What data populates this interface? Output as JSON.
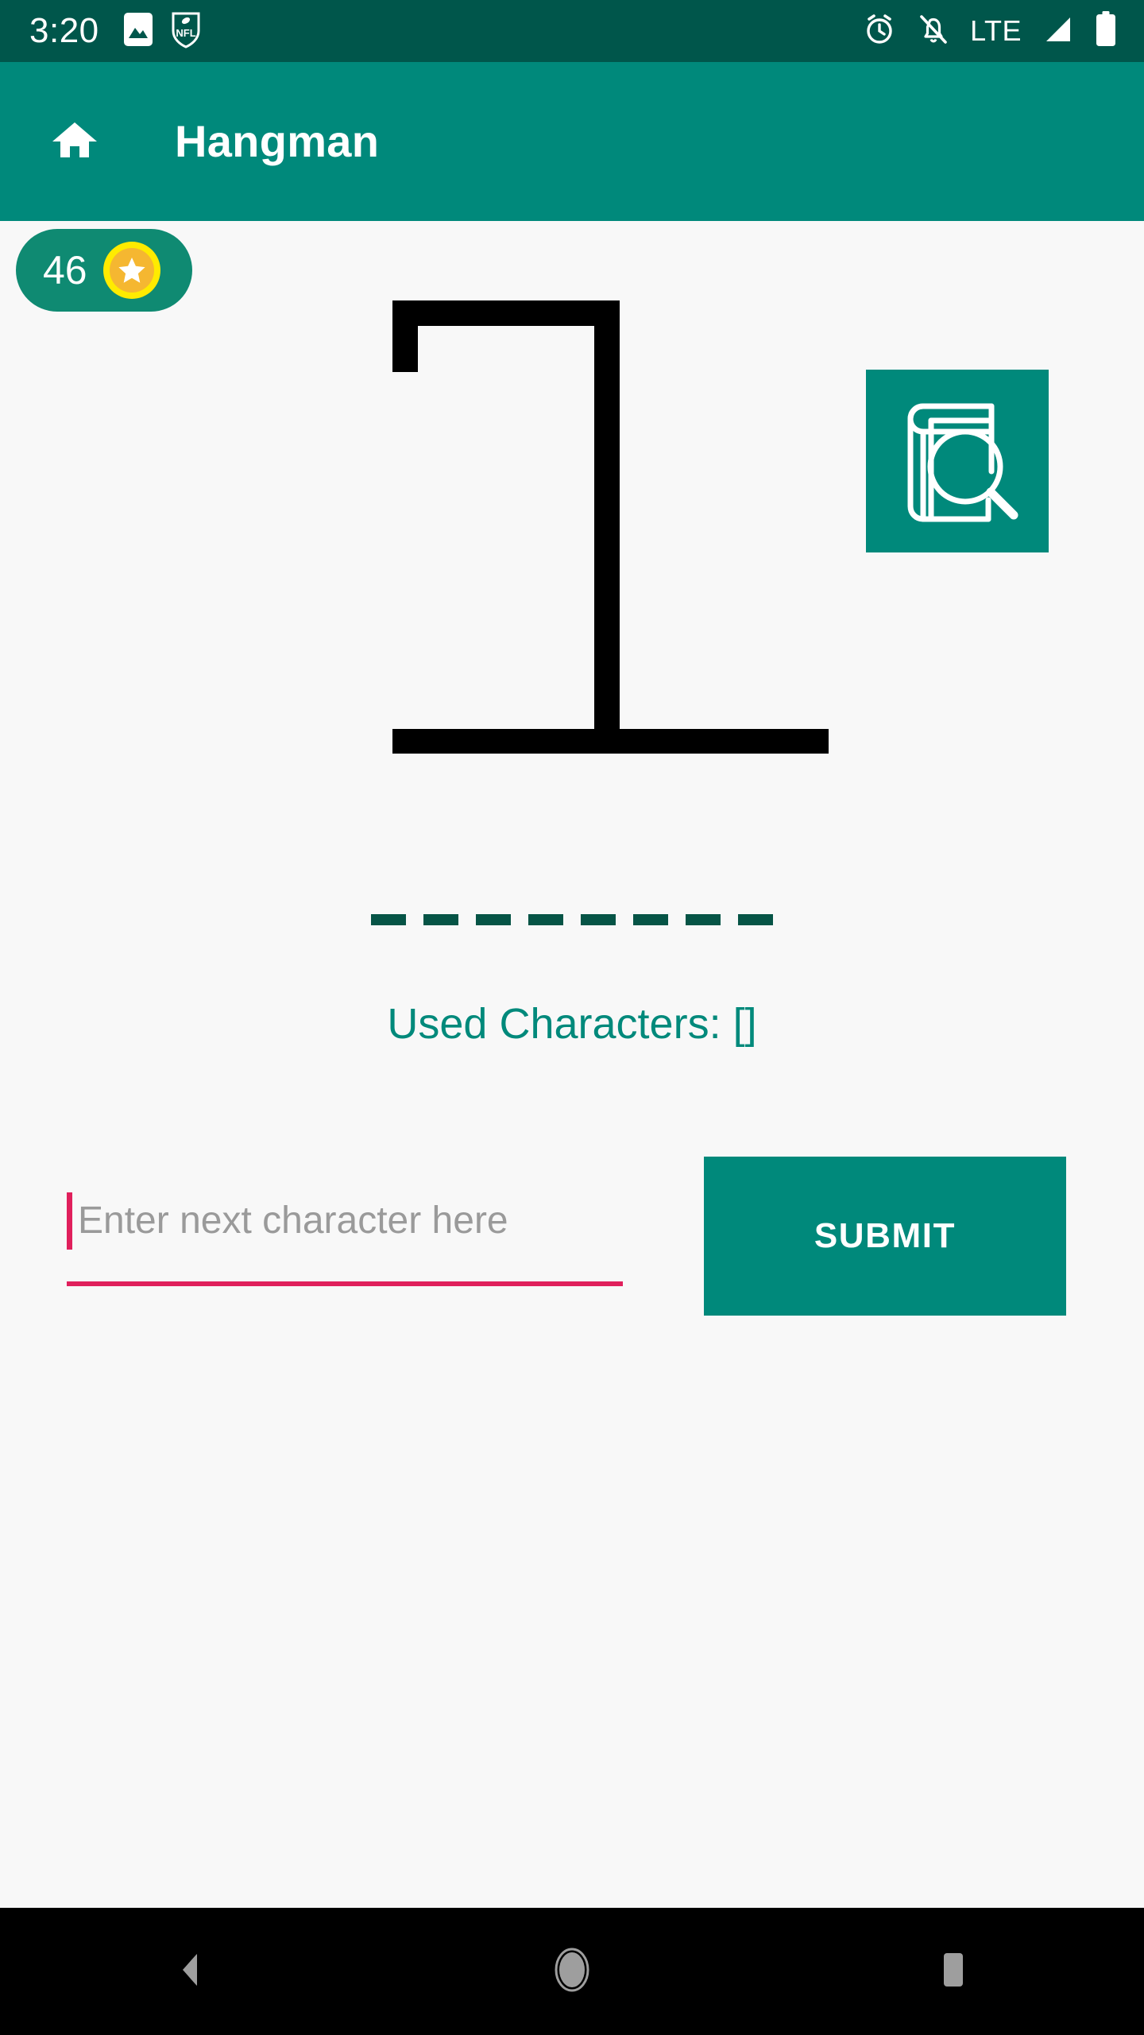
{
  "status_bar": {
    "time": "3:20",
    "network_label": "LTE",
    "left_icons": [
      "image-icon",
      "nfl-icon"
    ],
    "right_icons": [
      "alarm-icon",
      "notifications-off-icon",
      "signal-icon",
      "battery-icon"
    ],
    "background_color": "#00564B",
    "foreground_color": "#FFFFFF"
  },
  "app_bar": {
    "title": "Hangman",
    "home_icon": "home-icon",
    "background_color": "#00897B",
    "text_color": "#FFFFFF"
  },
  "score": {
    "value": "46",
    "icon": "star-coin-icon",
    "badge_color": "#0F8A72",
    "coin_ring_color": "#FFEB00",
    "coin_fill_color": "#F5B731"
  },
  "dictionary_button": {
    "icon": "book-search-icon",
    "background_color": "#00897B",
    "stroke_color": "#FFFFFF"
  },
  "gallows": {
    "description": "hangman-gallows-empty",
    "stroke_color": "#000000",
    "parts_drawn": 0
  },
  "word": {
    "blank_count": 8,
    "blanks": [
      "_",
      "_",
      "_",
      "_",
      "_",
      "_",
      "_",
      "_"
    ],
    "dash_color": "#065446"
  },
  "used_characters": {
    "label": "Used Characters: []",
    "text_color": "#00897B"
  },
  "input": {
    "value": "",
    "placeholder": "Enter next character here",
    "placeholder_color": "#9A9A9A",
    "accent_color": "#E0205C"
  },
  "submit": {
    "label": "SUBMIT",
    "background_color": "#00897B",
    "text_color": "#FFFFFF"
  },
  "nav_bar": {
    "back_label": "back-icon",
    "home_label": "home-circle-icon",
    "recents_label": "recents-icon",
    "background_color": "#000000",
    "icon_color": "#9E9E9E"
  }
}
